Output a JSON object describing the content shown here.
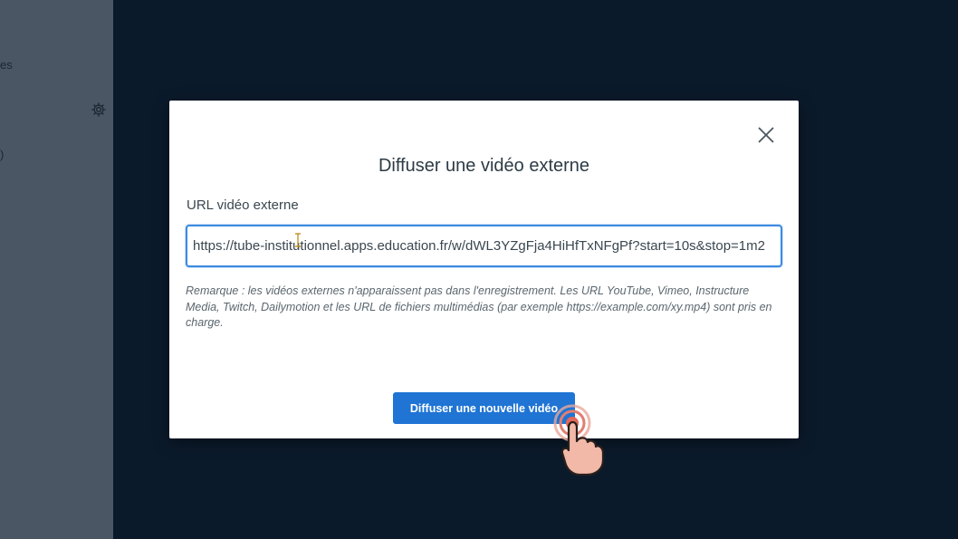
{
  "sidebar": {
    "text_1": "es",
    "text_2": ")",
    "gear_icon": "gear-icon"
  },
  "modal": {
    "title": "Diffuser une vidéo externe",
    "close_icon": "close-icon",
    "url_field": {
      "label": "URL vidéo externe",
      "value": "https://tube-institutionnel.apps.education.fr/w/dWL3YZgFja4HiHfTxNFgPf?start=10s&stop=1m2"
    },
    "note": "Remarque : les vidéos externes n'apparaissent pas dans l'enregistrement. Les URL YouTube, Vimeo, Instructure Media, Twitch, Dailymotion et les URL de fichiers multimédias (par exemple https://example.com/xy.mp4) sont pris en charge.",
    "submit_label": "Diffuser une nouvelle vidéo"
  },
  "colors": {
    "background": "#0b1a2b",
    "sidebar": "#4a5664",
    "primary": "#1f74d4",
    "input_focus": "#3d8be0"
  },
  "overlay": {
    "pointer_icon": "hand-tap-icon"
  }
}
